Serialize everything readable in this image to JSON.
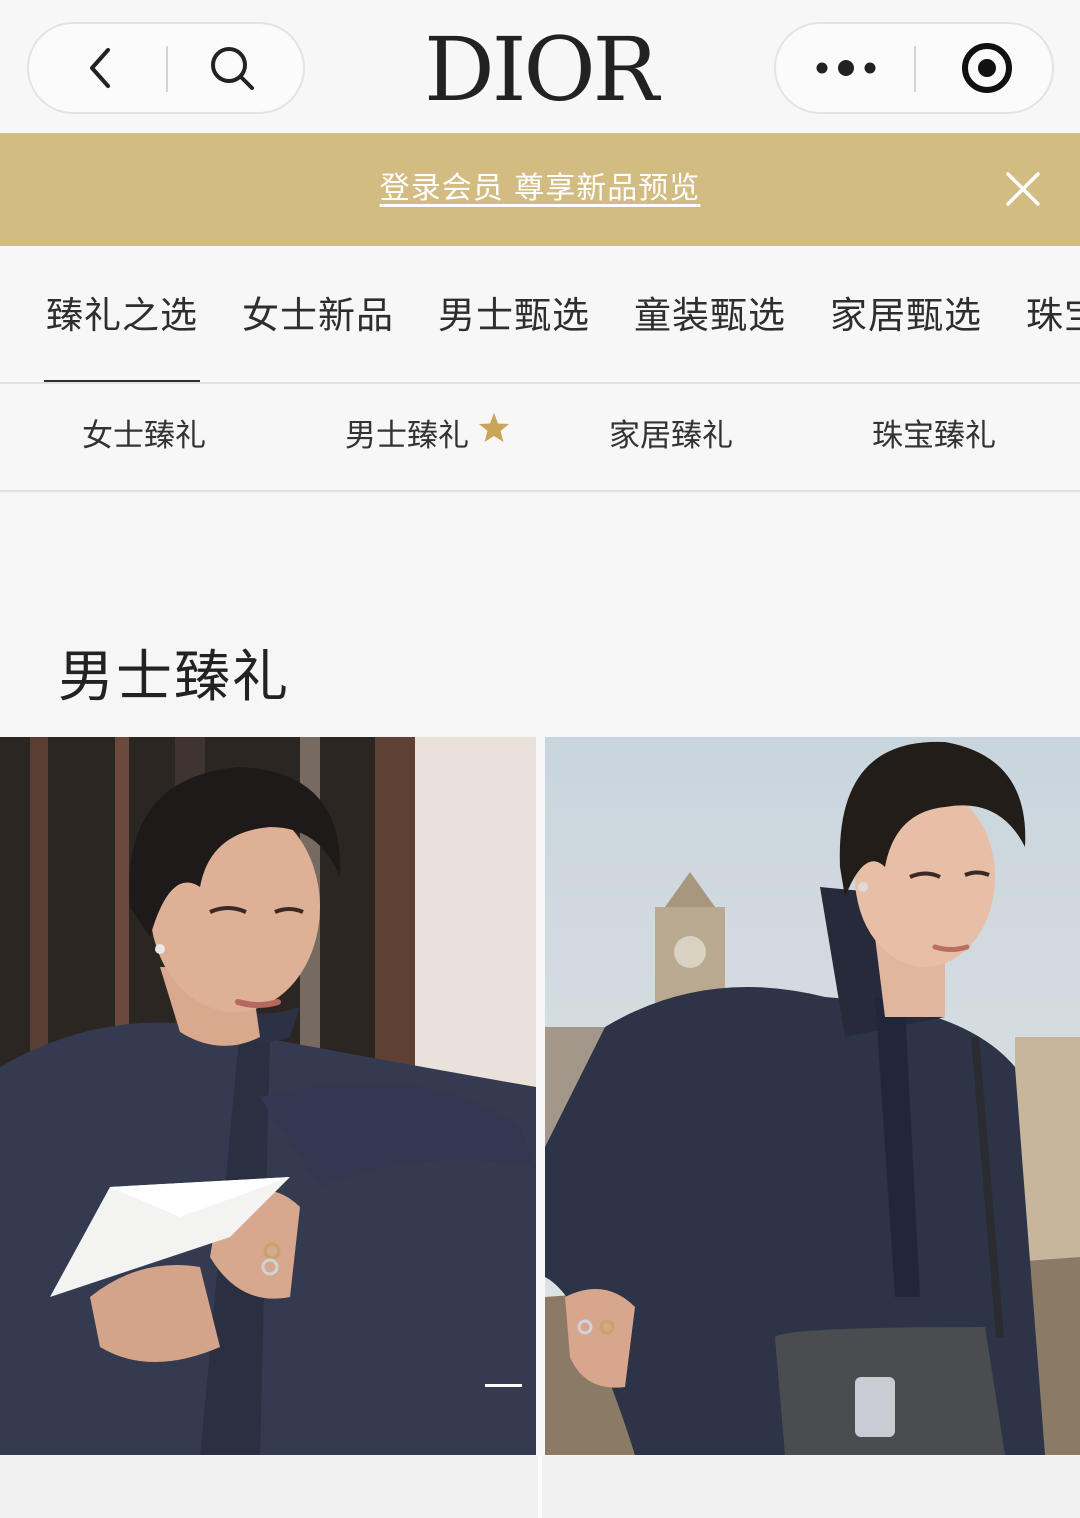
{
  "header": {
    "brand_logo": "DIOR",
    "left_capsule": {
      "back_icon": "chevron-left-icon",
      "search_icon": "search-icon"
    },
    "right_capsule": {
      "more_icon": "more-dots-icon",
      "close_icon": "target-circle-icon"
    }
  },
  "banner": {
    "text": "登录会员 尊享新品预览",
    "close_icon": "close-x-icon",
    "background_color": "#d3bc82"
  },
  "main_tabs": [
    {
      "label": "臻礼之选",
      "active": true
    },
    {
      "label": "女士新品",
      "active": false
    },
    {
      "label": "男士甄选",
      "active": false
    },
    {
      "label": "童装甄选",
      "active": false
    },
    {
      "label": "家居甄选",
      "active": false
    },
    {
      "label": "珠宝",
      "active": false
    }
  ],
  "sub_tabs": [
    {
      "label": "女士臻礼"
    },
    {
      "label": "男士臻礼",
      "badge_icon": "star-icon"
    },
    {
      "label": "家居臻礼"
    },
    {
      "label": "珠宝臻礼"
    }
  ],
  "section": {
    "title": "男士臻礼"
  },
  "cards": [
    {
      "image": "model-denim-jacket-paper-plane-photo"
    },
    {
      "image": "model-denim-jacket-rooftop-saddle-bag-photo"
    }
  ],
  "colors": {
    "accent_gold": "#d3bc82",
    "star_gold": "#c9a55a",
    "text_dark": "#2e2e2e"
  }
}
